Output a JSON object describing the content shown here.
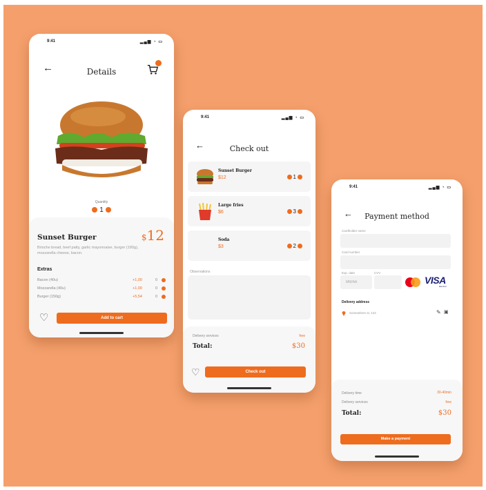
{
  "colors": {
    "background": "#f5a06c",
    "accent": "#ee6c1e",
    "card": "#f5f5f5"
  },
  "status_bar": {
    "time": "9:41",
    "icons": "signal-wifi-battery"
  },
  "details": {
    "title": "Details",
    "quantity_label": "Quantity",
    "quantity": "1",
    "product_name": "Sunset Burger",
    "price_currency": "$",
    "price_value": "12",
    "description": "Brioche bread, beef patty, garlic mayonnaise, burger (180g), mozzarella cheese, bacon.",
    "extras_heading": "Extras",
    "extras": [
      {
        "name": "Bacon (40u)",
        "price": "+1,00",
        "qty": "0"
      },
      {
        "name": "Mozzarella (40u)",
        "price": "+1,00",
        "qty": "0"
      },
      {
        "name": "Burger (150g)",
        "price": "+5,54",
        "qty": "0"
      }
    ],
    "add_to_cart": "Add to cart"
  },
  "checkout": {
    "title": "Check out",
    "items": [
      {
        "name": "Sunset Burger",
        "price": "$12",
        "qty": "1"
      },
      {
        "name": "Large fries",
        "price": "$6",
        "qty": "3"
      },
      {
        "name": "Soda",
        "price": "$3",
        "qty": "2"
      }
    ],
    "observations_label": "Observations",
    "delivery_label": "Delivery services",
    "delivery_value": "free",
    "total_label": "Total:",
    "total_value": "$30",
    "button": "Check out"
  },
  "payment": {
    "title": "Payment method",
    "cardholder_label": "Cardholder name",
    "card_number_label": "Card number",
    "expiry_label": "Exp. date",
    "expiry_placeholder": "MM/AA",
    "cvv_label": "CVV",
    "card_brand_1": "mastercard",
    "card_brand_2": "VISA",
    "card_brand_2_sub": "Electron",
    "delivery_address_label": "Delivery address",
    "address": "Somewhere st, 124",
    "delivery_time_label": "Delivery time",
    "delivery_time_value": "30-40min",
    "delivery_services_label": "Delivery services",
    "delivery_services_value": "free",
    "total_label": "Total:",
    "total_value": "$30",
    "button": "Make a payment"
  }
}
